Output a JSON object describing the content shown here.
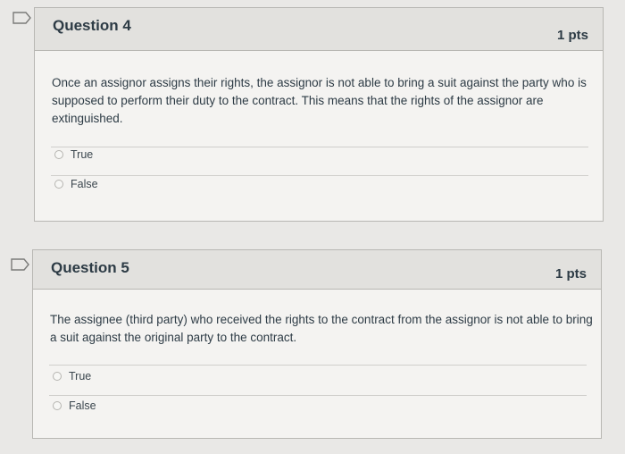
{
  "questions": [
    {
      "title": "Question 4",
      "points": "1 pts",
      "text": "Once an assignor assigns their rights, the assignor is not able to bring a suit against the party who is supposed to perform their duty to the contract. This means that the rights of the assignor are extinguished.",
      "answers": [
        "True",
        "False"
      ]
    },
    {
      "title": "Question 5",
      "points": "1 pts",
      "text": "The assignee (third party) who received the rights to the contract from the assignor is not able to bring a suit against the original party to the contract.",
      "answers": [
        "True",
        "False"
      ]
    }
  ],
  "icons": {
    "flag": "flag-outline-icon",
    "radio": "radio-empty-icon"
  },
  "colors": {
    "background": "#e9e8e6",
    "header": "#e2e1de",
    "body": "#f4f3f1",
    "text": "#2d3b45"
  }
}
